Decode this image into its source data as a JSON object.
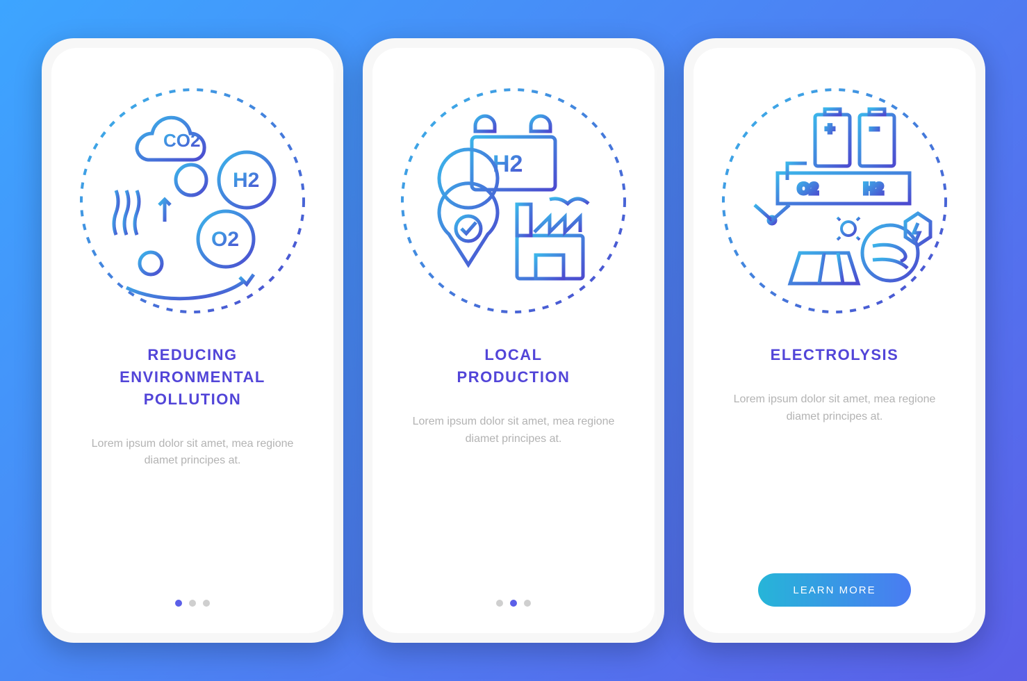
{
  "screens": [
    {
      "title": "REDUCING\nENVIRONMENTAL\nPOLLUTION",
      "body": "Lorem ipsum dolor sit amet, mea regione diamet principes at.",
      "activeDot": 0,
      "hasDots": true,
      "hasCta": false,
      "labels": {
        "co2": "CO2",
        "h2": "H2",
        "o2": "O2"
      }
    },
    {
      "title": "LOCAL\nPRODUCTION",
      "body": "Lorem ipsum dolor sit amet, mea regione diamet principes at.",
      "activeDot": 1,
      "hasDots": true,
      "hasCta": false,
      "labels": {
        "h2": "H2"
      }
    },
    {
      "title": "ELECTROLYSIS",
      "body": "Lorem ipsum dolor sit amet, mea regione diamet principes at.",
      "activeDot": 2,
      "hasDots": false,
      "hasCta": true,
      "labels": {
        "o2": "O2",
        "h2": "H2",
        "plus": "+",
        "minus": "−"
      }
    }
  ],
  "cta": {
    "label": "LEARN MORE"
  }
}
